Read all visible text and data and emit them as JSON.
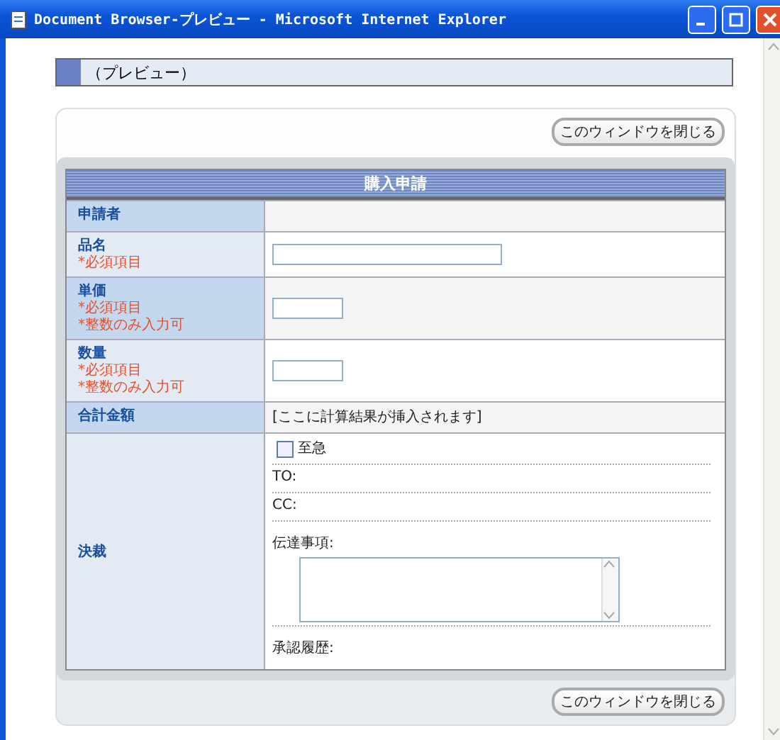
{
  "window": {
    "title": "Document Browser-プレビュー - Microsoft Internet Explorer"
  },
  "page_heading": "（プレビュー）",
  "top_button": "このウィンドウを閉じる",
  "form": {
    "title": "購入申請",
    "rows": [
      {
        "label": "申請者",
        "notes": [],
        "kind": "empty"
      },
      {
        "label": "品名",
        "notes": [
          "*必須項目"
        ],
        "kind": "long_input"
      },
      {
        "label": "単価",
        "notes": [
          "*必須項目",
          "*整数のみ入力可"
        ],
        "kind": "short_input"
      },
      {
        "label": "数量",
        "notes": [
          "*必須項目",
          "*整数のみ入力可"
        ],
        "kind": "short_input"
      },
      {
        "label": "合計金額",
        "notes": [],
        "kind": "computed",
        "value": "[ここに計算結果が挿入されます]"
      },
      {
        "label": "決裁",
        "notes": [],
        "kind": "approval",
        "urgent": {
          "label": "至急",
          "checked": false
        },
        "to": "TO:",
        "cc": "CC:",
        "message": "伝達事項:",
        "history": "承認履歴:"
      }
    ]
  },
  "bottom_button": "このウィンドウを閉じる"
}
